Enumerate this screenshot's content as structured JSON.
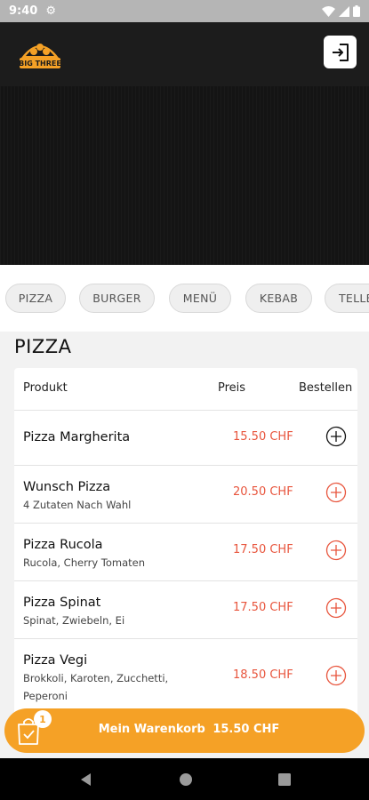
{
  "status_bar": {
    "time": "9:40"
  },
  "header": {
    "logo_text": "BIG THREE"
  },
  "category_tabs": [
    "PIZZA",
    "BURGER",
    "MENÜ",
    "KEBAB",
    "TELLE"
  ],
  "section_title": "PIZZA",
  "table": {
    "headers": {
      "product": "Produkt",
      "price": "Preis",
      "order": "Bestellen"
    },
    "rows": [
      {
        "name": "Pizza Margherita",
        "description": "",
        "price": "15.50 CHF"
      },
      {
        "name": "Wunsch Pizza",
        "description": "4 Zutaten Nach Wahl",
        "price": "20.50 CHF"
      },
      {
        "name": "Pizza Rucola",
        "description": "Rucola, Cherry Tomaten",
        "price": "17.50 CHF"
      },
      {
        "name": "Pizza Spinat",
        "description": "Spinat, Zwiebeln, Ei",
        "price": "17.50 CHF"
      },
      {
        "name": "Pizza Vegi",
        "description": "Brokkoli, Karoten, Zucchetti, Peperoni",
        "price": "18.50 CHF"
      }
    ]
  },
  "cart": {
    "badge_count": "1",
    "label": "Mein Warenkorb",
    "total": "15.50 CHF"
  },
  "colors": {
    "accent_orange": "#f5a126",
    "price_red": "#e8553d",
    "header_dark": "#1c1c1c"
  },
  "icons": {
    "status": [
      "gear-icon",
      "wifi-icon",
      "signal-icon",
      "battery-icon"
    ],
    "header": [
      "logout-icon"
    ],
    "row_action": "add-circle-icon",
    "cart": "shopping-bag-icon",
    "nav": [
      "back-icon",
      "home-icon",
      "recents-icon"
    ]
  }
}
